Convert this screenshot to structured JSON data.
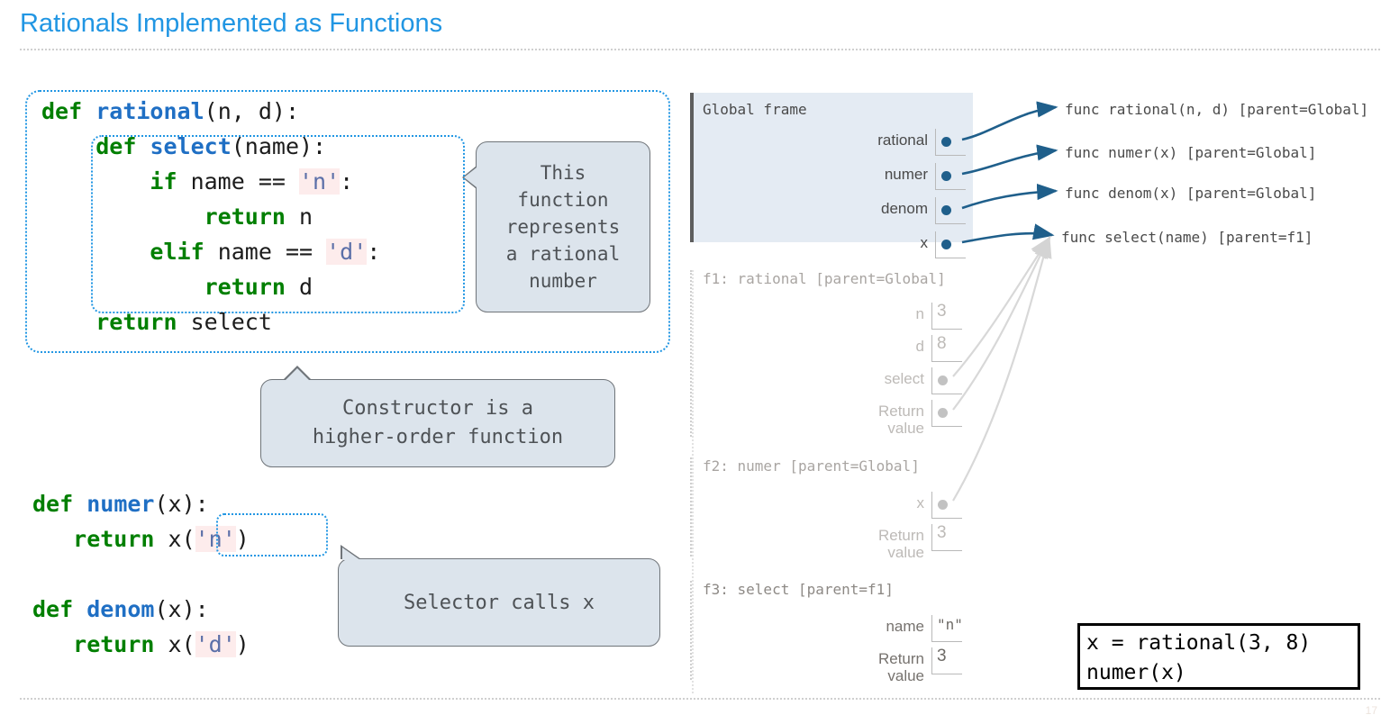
{
  "header": {
    "title": "Rationals Implemented as Functions",
    "page_number": "17"
  },
  "code_blocks": {
    "rational_def": {
      "lines": [
        "def rational(n, d):",
        "    def select(name):",
        "        if name == 'n':",
        "            return n",
        "        elif name == 'd':",
        "            return d",
        "    return select"
      ]
    },
    "selectors": {
      "lines": [
        "def numer(x):",
        "    return x('n')",
        "",
        "def denom(x):",
        "    return x('d')"
      ]
    },
    "execution": {
      "lines": [
        "x = rational(3, 8)",
        "numer(x)"
      ]
    }
  },
  "callouts": [
    {
      "id": "represents",
      "text": "This\nfunction\nrepresents\na rational\nnumber",
      "pointer": "left"
    },
    {
      "id": "higher-order",
      "text": "Constructor is a\nhigher-order function",
      "pointer": "top"
    },
    {
      "id": "selector",
      "text": "Selector calls x",
      "pointer": "top-left"
    }
  ],
  "env_diagram": {
    "frames": [
      {
        "id": "global",
        "title": "Global frame",
        "active": true,
        "bindings": [
          {
            "name": "rational",
            "value": "",
            "is_pointer": true
          },
          {
            "name": "numer",
            "value": "",
            "is_pointer": true
          },
          {
            "name": "denom",
            "value": "",
            "is_pointer": true
          },
          {
            "name": "x",
            "value": "",
            "is_pointer": true
          }
        ]
      },
      {
        "id": "f1",
        "title": "f1: rational [parent=Global]",
        "active": false,
        "bindings": [
          {
            "name": "n",
            "value": "3",
            "is_pointer": false
          },
          {
            "name": "d",
            "value": "8",
            "is_pointer": false
          },
          {
            "name": "select",
            "value": "",
            "is_pointer": true
          },
          {
            "name": "Return\nvalue",
            "value": "",
            "is_pointer": true
          }
        ]
      },
      {
        "id": "f2",
        "title": "f2: numer [parent=Global]",
        "active": false,
        "bindings": [
          {
            "name": "x",
            "value": "",
            "is_pointer": true
          },
          {
            "name": "Return\nvalue",
            "value": "3",
            "is_pointer": false
          }
        ]
      },
      {
        "id": "f3",
        "title": "f3: select [parent=f1]",
        "active": true,
        "bindings": [
          {
            "name": "name",
            "value": "\"n\"",
            "is_pointer": false
          },
          {
            "name": "Return\nvalue",
            "value": "3",
            "is_pointer": false
          }
        ]
      }
    ],
    "function_values": [
      {
        "label": "func rational(n, d) [parent=Global]"
      },
      {
        "label": "func numer(x) [parent=Global]"
      },
      {
        "label": "func denom(x) [parent=Global]"
      },
      {
        "label": "func select(name) [parent=f1]"
      }
    ]
  },
  "colors": {
    "title_blue": "#2196e3",
    "keyword_green": "#007f00",
    "function_blue": "#1f6fc4",
    "string_highlight": "#fdecec",
    "callout_fill": "#dce4ec",
    "frame_fill": "#e4ebf3",
    "arrow_blue": "#1f5f8b",
    "arrow_gray": "#d2d2d2"
  }
}
